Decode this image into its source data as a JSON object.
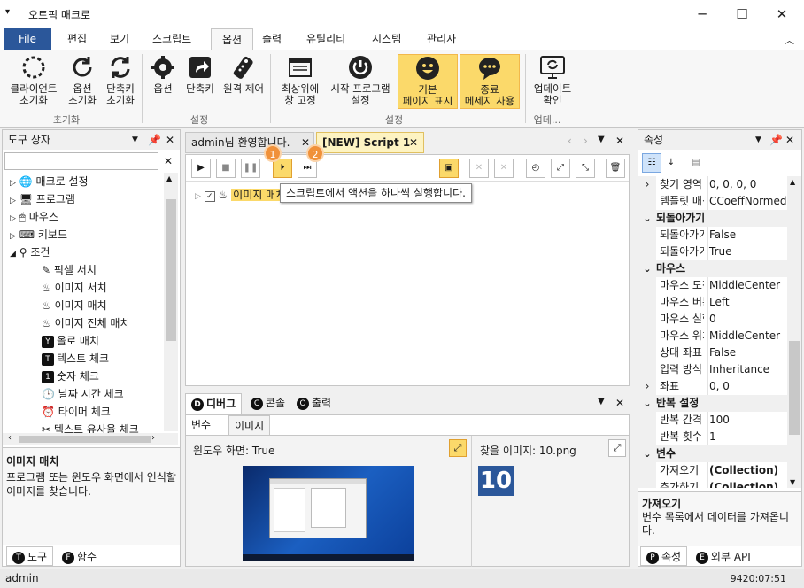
{
  "titlebar": {
    "title": "오토픽 매크로"
  },
  "menu": {
    "file": "File",
    "items": [
      "편집",
      "보기",
      "스크립트",
      "옵션",
      "출력",
      "유틸리티",
      "시스템",
      "관리자"
    ]
  },
  "ribbon": {
    "buttons": [
      "클라이언트\n초기화",
      "옵션\n초기화",
      "단축키\n초기화",
      "옵션",
      "단축키",
      "원격 제어",
      "최상위에\n창 고정",
      "시작 프로그램\n설정",
      "기본\n페이지 표시",
      "종료\n메세지 사용",
      "업데이트\n확인"
    ],
    "groups": [
      "초기화",
      "설정",
      "설정",
      "업데..."
    ]
  },
  "toolbox": {
    "title": "도구 상자",
    "items": [
      "매크로 설정",
      "프로그램",
      "마우스",
      "키보드",
      "조건",
      "픽셀 서치",
      "이미지 서치",
      "이미지 매치",
      "이미지 전체 매치",
      "올로 매치",
      "텍스트 체크",
      "숫자 체크",
      "날짜 시간 체크",
      "타이머 체크",
      "텍스트 유사율 체크"
    ],
    "desc_title": "이미지 매치",
    "desc_text": "프로그램 또는 윈도우 화면에서 인식할 이미지를 찾습니다.",
    "tabs": [
      "도구",
      "함수"
    ]
  },
  "editor": {
    "tabs": [
      "admin님 환영합니다.",
      "[NEW] Script 1"
    ],
    "node_label": "이미지 매치",
    "tooltip": "스크립트에서 액션을 하나씩 실행합니다.",
    "badges": [
      "1",
      "2"
    ]
  },
  "debug": {
    "tabs": [
      "디버그",
      "콘솔",
      "출력"
    ],
    "subtabs": [
      "변수",
      "이미지"
    ],
    "window_label": "윈도우 화면: True",
    "find_label": "찾을 이미지: 10.png",
    "find_number": "10"
  },
  "props": {
    "title": "속성",
    "rows": [
      {
        "k": "찾기 영역",
        "v": "0, 0, 0, 0",
        "type": "row",
        "exp": "›"
      },
      {
        "k": "템플릿 매칭",
        "v": "CCoeffNormed",
        "type": "row"
      },
      {
        "k": "되돌아가기",
        "v": "",
        "type": "cat"
      },
      {
        "k": "되돌아가기",
        "v": "False",
        "type": "row"
      },
      {
        "k": "되돌아가기",
        "v": "True",
        "type": "row"
      },
      {
        "k": "마우스",
        "v": "",
        "type": "cat"
      },
      {
        "k": "마우스 도착",
        "v": "MiddleCenter",
        "type": "row"
      },
      {
        "k": "마우스 버튼",
        "v": "Left",
        "type": "row"
      },
      {
        "k": "마우스 실행",
        "v": "0",
        "type": "row"
      },
      {
        "k": "마우스 위치",
        "v": "MiddleCenter",
        "type": "row"
      },
      {
        "k": "상대 좌표",
        "v": "False",
        "type": "row"
      },
      {
        "k": "입력 방식",
        "v": "Inheritance",
        "type": "row"
      },
      {
        "k": "좌표",
        "v": "0, 0",
        "type": "row",
        "exp": "›"
      },
      {
        "k": "반복 설정",
        "v": "",
        "type": "cat"
      },
      {
        "k": "반복 간격",
        "v": "100",
        "type": "row"
      },
      {
        "k": "반복 횟수",
        "v": "1",
        "type": "row"
      },
      {
        "k": "변수",
        "v": "",
        "type": "cat"
      },
      {
        "k": "가져오기",
        "v": "(Collection)",
        "type": "row",
        "bold": true
      },
      {
        "k": "추가하기",
        "v": "(Collection)",
        "type": "row",
        "bold": true
      }
    ],
    "desc_title": "가져오기",
    "desc_text": "변수 목록에서 데이터를 가져옵니다.",
    "tabs": [
      "속성",
      "외부 API"
    ]
  },
  "status": {
    "user": "admin",
    "time": "9420:07:51"
  },
  "colors": {
    "accent": "#2b579a",
    "highlight": "#fbd96a",
    "badge": "#f0913a"
  }
}
